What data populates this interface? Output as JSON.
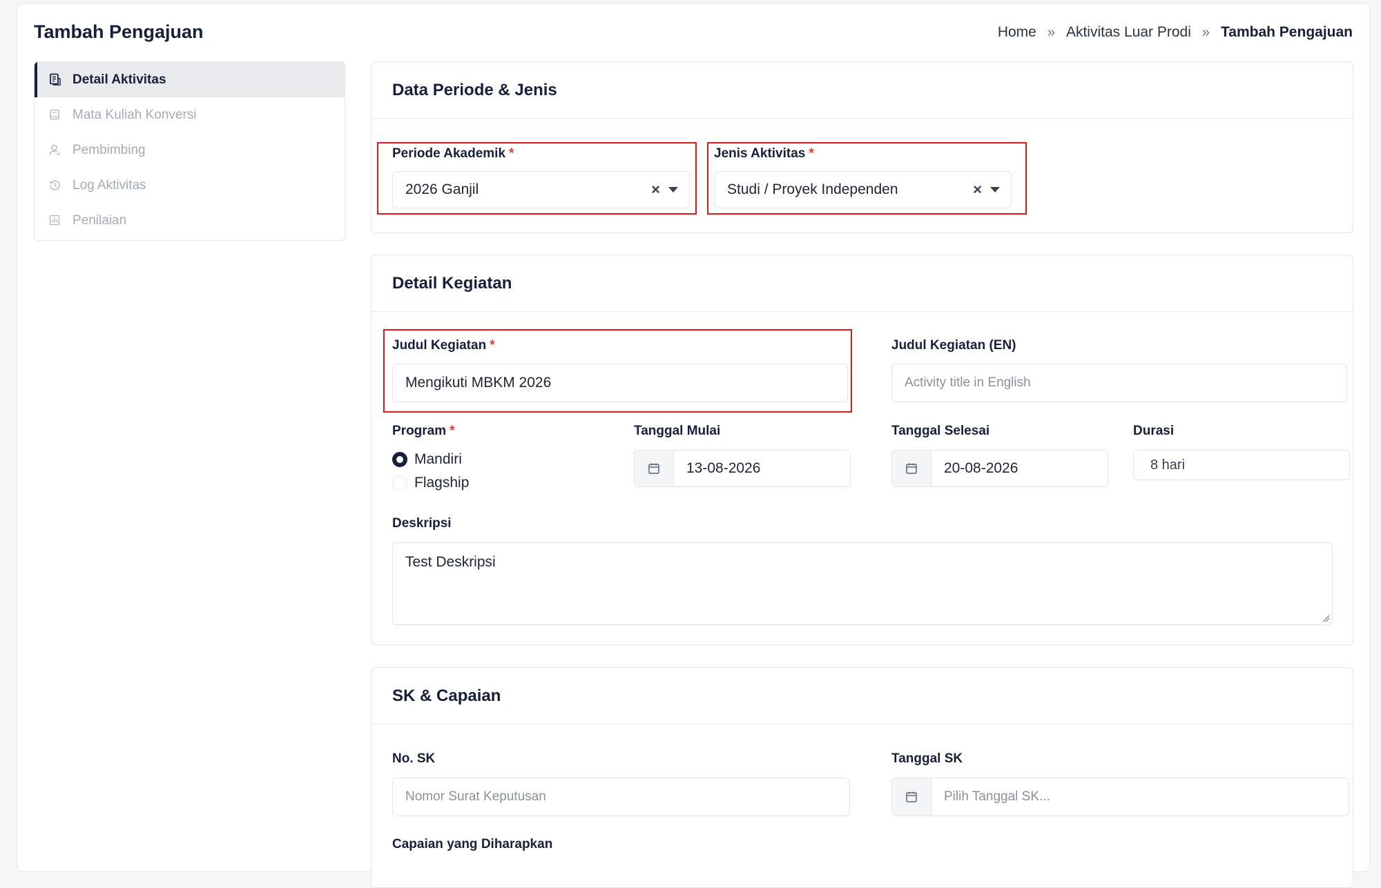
{
  "page": {
    "title": "Tambah Pengajuan"
  },
  "breadcrumb": {
    "home": "Home",
    "section": "Aktivitas Luar Prodi",
    "current": "Tambah Pengajuan",
    "separator": "»"
  },
  "sidebar": {
    "items": [
      {
        "label": "Detail Aktivitas",
        "icon": "document-icon",
        "active": true
      },
      {
        "label": "Mata Kuliah Konversi",
        "icon": "book-icon",
        "active": false
      },
      {
        "label": "Pembimbing",
        "icon": "user-icon",
        "active": false
      },
      {
        "label": "Log Aktivitas",
        "icon": "history-icon",
        "active": false
      },
      {
        "label": "Penilaian",
        "icon": "chart-icon",
        "active": false
      }
    ]
  },
  "periode_jenis": {
    "title": "Data Periode & Jenis",
    "periode_label": "Periode Akademik",
    "periode_value": "2026 Ganjil",
    "jenis_label": "Jenis Aktivitas",
    "jenis_value": "Studi / Proyek Independen",
    "required_mark": "*",
    "clear_symbol": "×"
  },
  "detail_kegiatan": {
    "title": "Detail Kegiatan",
    "judul_label": "Judul Kegiatan",
    "judul_value": "Mengikuti MBKM 2026",
    "judul_en_label": "Judul Kegiatan (EN)",
    "judul_en_placeholder": "Activity title in English",
    "program_label": "Program",
    "program_options": [
      "Mandiri",
      "Flagship"
    ],
    "program_selected": "Mandiri",
    "tanggal_mulai_label": "Tanggal Mulai",
    "tanggal_mulai_value": "13-08-2026",
    "tanggal_selesai_label": "Tanggal Selesai",
    "tanggal_selesai_value": "20-08-2026",
    "durasi_label": "Durasi",
    "durasi_value": "8 hari",
    "deskripsi_label": "Deskripsi",
    "deskripsi_value": "Test Deskripsi"
  },
  "sk_capaian": {
    "title": "SK & Capaian",
    "no_sk_label": "No. SK",
    "no_sk_placeholder": "Nomor Surat Keputusan",
    "tanggal_sk_label": "Tanggal SK",
    "tanggal_sk_placeholder": "Pilih Tanggal SK...",
    "capaian_label": "Capaian yang Diharapkan"
  },
  "colors": {
    "accent": "#17203a",
    "required": "#e53935",
    "highlight_box": "#e0161b"
  }
}
